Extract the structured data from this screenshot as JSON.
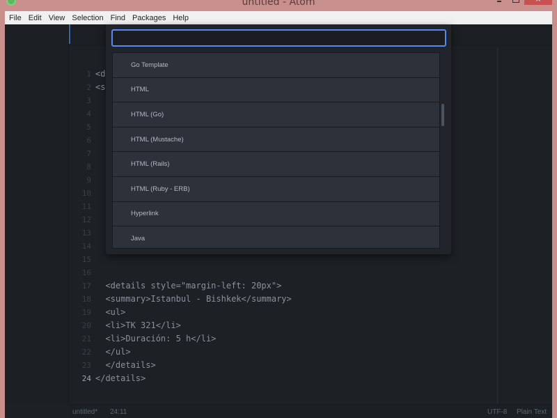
{
  "window": {
    "title": "untitled - Atom",
    "controls": {
      "minimize": "minimize",
      "maximize": "maximize",
      "close": "×"
    }
  },
  "menubar": [
    "File",
    "Edit",
    "View",
    "Selection",
    "Find",
    "Packages",
    "Help"
  ],
  "grammar_selector": {
    "query": "",
    "placeholder": "",
    "items": [
      "Go Template",
      "HTML",
      "HTML (Go)",
      "HTML (Mustache)",
      "HTML (Rails)",
      "HTML (Ruby - ERB)",
      "Hyperlink",
      "Java"
    ]
  },
  "editor": {
    "lines": [
      {
        "n": "1",
        "text": "<d"
      },
      {
        "n": "2",
        "text": "<s"
      },
      {
        "n": "3",
        "text": ""
      },
      {
        "n": "4",
        "text": ""
      },
      {
        "n": "5",
        "text": ""
      },
      {
        "n": "6",
        "text": ""
      },
      {
        "n": "7",
        "text": ""
      },
      {
        "n": "8",
        "text": ""
      },
      {
        "n": "9",
        "text": ""
      },
      {
        "n": "10",
        "text": ""
      },
      {
        "n": "11",
        "text": ""
      },
      {
        "n": "12",
        "text": ""
      },
      {
        "n": "13",
        "text": ""
      },
      {
        "n": "14",
        "text": ""
      },
      {
        "n": "15",
        "text": ""
      },
      {
        "n": "16",
        "text": ""
      },
      {
        "n": "17",
        "text": "  <details style=\"margin-left: 20px\">"
      },
      {
        "n": "18",
        "text": "  <summary>Istanbul - Bishkek</summary>"
      },
      {
        "n": "19",
        "text": "  <ul>"
      },
      {
        "n": "20",
        "text": "  <li>TK 321</li>"
      },
      {
        "n": "21",
        "text": "  <li>Duración: 5 h</li>"
      },
      {
        "n": "22",
        "text": "  </ul>"
      },
      {
        "n": "23",
        "text": "  </details>"
      },
      {
        "n": "24",
        "text": "</details>"
      }
    ],
    "active_line": "24"
  },
  "statusbar": {
    "file": "untitled*",
    "cursor": "24:11",
    "encoding": "UTF-8",
    "grammar": "Plain Text"
  }
}
